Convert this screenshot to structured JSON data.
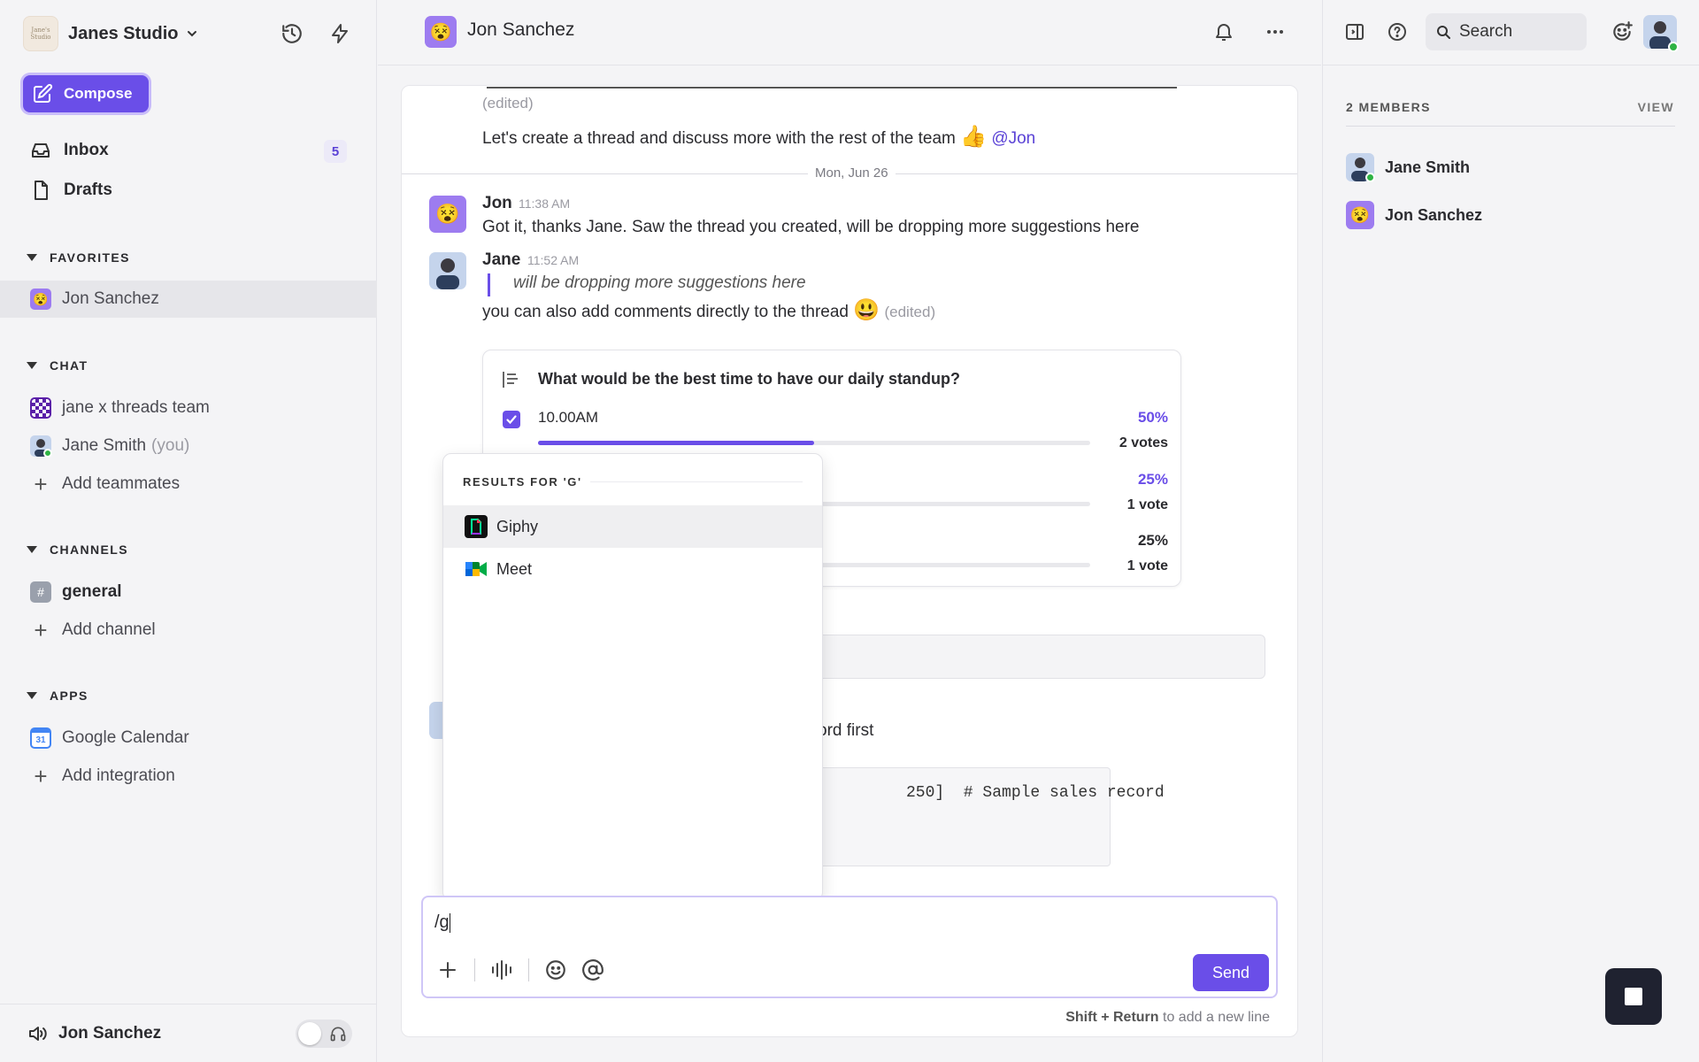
{
  "workspace": {
    "name": "Janes Studio",
    "logo_text": "Jane's Studio"
  },
  "sidebar": {
    "compose_label": "Compose",
    "inbox": {
      "label": "Inbox",
      "count": "5"
    },
    "drafts": {
      "label": "Drafts"
    },
    "favorites": {
      "title": "FAVORITES",
      "items": [
        {
          "label": "Jon Sanchez"
        }
      ]
    },
    "chat": {
      "title": "CHAT",
      "items": [
        {
          "label": "jane x threads team"
        },
        {
          "label": "Jane Smith",
          "suffix": "(you)"
        }
      ],
      "add_label": "Add teammates"
    },
    "channels": {
      "title": "CHANNELS",
      "items": [
        {
          "label": "general"
        }
      ],
      "add_label": "Add channel"
    },
    "apps": {
      "title": "APPS",
      "items": [
        {
          "label": "Google Calendar"
        }
      ],
      "add_label": "Add integration"
    },
    "footer": {
      "user": "Jon Sanchez"
    }
  },
  "header": {
    "title": "Jon Sanchez"
  },
  "messages": {
    "edited_tag": "(edited)",
    "prev_text": "Let's create a thread and discuss more with the rest of the team",
    "prev_mention": "@Jon",
    "date_divider": "Mon, Jun 26",
    "jon": {
      "author": "Jon",
      "time": "11:38 AM",
      "text": "Got it, thanks Jane. Saw the thread you created, will be dropping more suggestions here"
    },
    "jane": {
      "author": "Jane",
      "time": "11:52 AM",
      "quote": "will be dropping more suggestions here",
      "text": "you can also add comments directly to the thread",
      "edited": "(edited)"
    },
    "partial_text": "ord first",
    "code_text": "250]  # Sample sales record"
  },
  "poll": {
    "question": "What would be the best time to have our daily standup?",
    "options": [
      {
        "label": "10.00AM",
        "percent": "50%",
        "votes": "2 votes",
        "fraction": 0.5,
        "checked": true
      },
      {
        "label": "",
        "percent": "25%",
        "votes": "1 vote",
        "fraction": 0.25,
        "checked": false
      },
      {
        "label": "",
        "percent": "25%",
        "votes": "1 vote",
        "fraction": 0.25,
        "checked": false
      }
    ]
  },
  "command_popup": {
    "title": "RESULTS FOR 'G'",
    "items": [
      {
        "label": "Giphy",
        "icon": "giphy-icon"
      },
      {
        "label": "Meet",
        "icon": "meet-icon"
      }
    ]
  },
  "composer": {
    "value": "/g",
    "send_label": "Send",
    "hint_keys": "Shift + Return",
    "hint_rest": "to add a new line"
  },
  "right_panel": {
    "search_placeholder": "Search",
    "members_title": "2 MEMBERS",
    "view_label": "VIEW",
    "members": [
      {
        "name": "Jane Smith"
      },
      {
        "name": "Jon Sanchez"
      }
    ]
  },
  "colors": {
    "accent": "#6a4ee8",
    "online": "#2fb344"
  }
}
